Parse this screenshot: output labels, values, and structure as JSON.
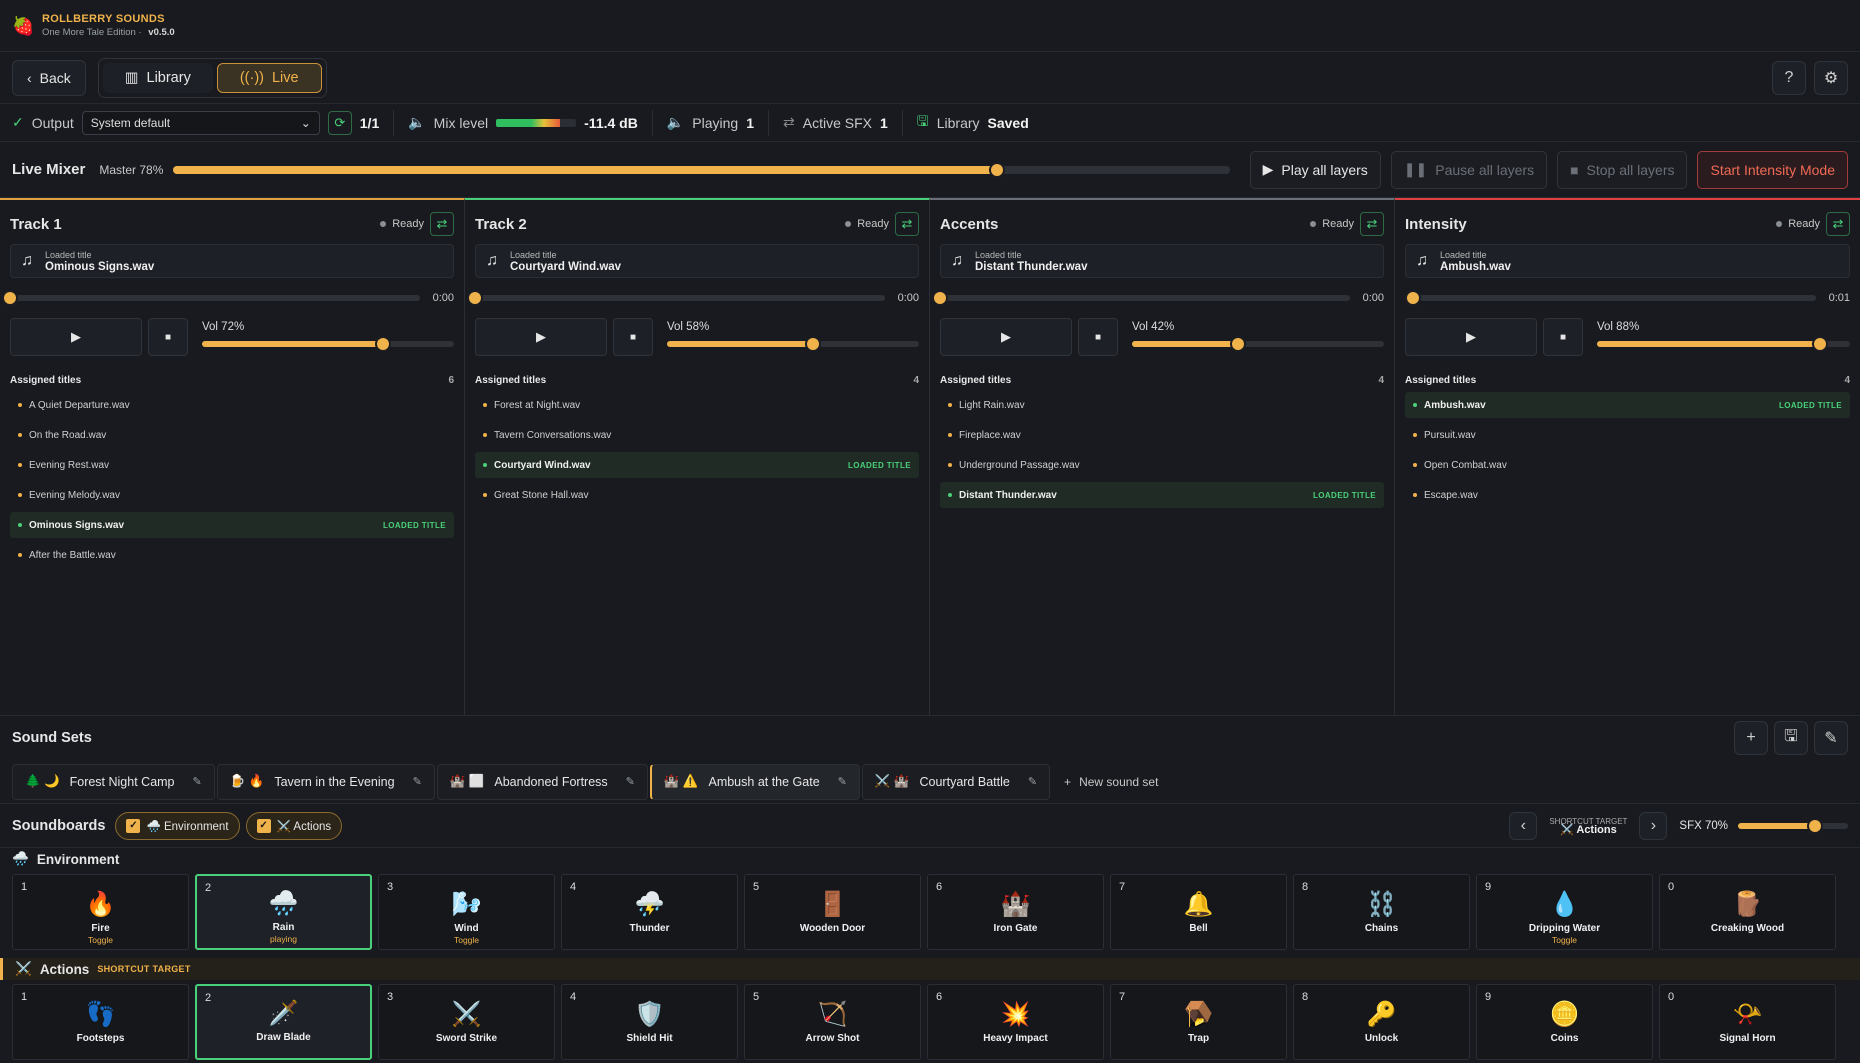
{
  "brand": {
    "name": "ROLLBERRY SOUNDS",
    "edition": "One More Tale Edition",
    "version": "v0.5.0",
    "sep": "·"
  },
  "nav": {
    "back": "Back",
    "library": "Library",
    "live": "Live"
  },
  "status": {
    "output_label": "Output",
    "output_value": "System default",
    "count": "1/1",
    "mix_label": "Mix level",
    "mix_db": "-11.4 dB",
    "mix_level": 0.8,
    "playing_label": "Playing",
    "playing_value": "1",
    "sfx_label": "Active SFX",
    "sfx_value": "1",
    "lib_label": "Library",
    "lib_value": "Saved"
  },
  "mixer": {
    "title": "Live Mixer",
    "master": "Master 78%",
    "master_value": 0.78,
    "play_all": "Play all layers",
    "pause_all": "Pause all layers",
    "stop_all": "Stop all layers",
    "intensity": "Start Intensity Mode"
  },
  "tracks": [
    {
      "name": "Track 1",
      "state": "Ready",
      "accent": "#e0a040",
      "loaded_label": "Loaded title",
      "loaded": "Ominous Signs.wav",
      "time": "0:00",
      "pos": 0.0,
      "vol_label": "Vol 72%",
      "vol": 0.72,
      "assigned_label": "Assigned titles",
      "count": "6",
      "items": [
        "A Quiet Departure.wav",
        "On the Road.wav",
        "Evening Rest.wav",
        "Evening Melody.wav",
        "Ominous Signs.wav",
        "After the Battle.wav"
      ],
      "active": 4
    },
    {
      "name": "Track 2",
      "state": "Ready",
      "accent": "#4ad07a",
      "loaded_label": "Loaded title",
      "loaded": "Courtyard Wind.wav",
      "time": "0:00",
      "pos": 0.0,
      "vol_label": "Vol 58%",
      "vol": 0.58,
      "assigned_label": "Assigned titles",
      "count": "4",
      "items": [
        "Forest at Night.wav",
        "Tavern Conversations.wav",
        "Courtyard Wind.wav",
        "Great Stone Hall.wav"
      ],
      "active": 2
    },
    {
      "name": "Accents",
      "state": "Ready",
      "accent": "#6a6e76",
      "loaded_label": "Loaded title",
      "loaded": "Distant Thunder.wav",
      "time": "0:00",
      "pos": 0.0,
      "vol_label": "Vol 42%",
      "vol": 0.42,
      "assigned_label": "Assigned titles",
      "count": "4",
      "items": [
        "Light Rain.wav",
        "Fireplace.wav",
        "Underground Passage.wav",
        "Distant Thunder.wav"
      ],
      "active": 3
    },
    {
      "name": "Intensity",
      "state": "Ready",
      "accent": "#e04040",
      "loaded_label": "Loaded title",
      "loaded": "Ambush.wav",
      "time": "0:01",
      "pos": 0.02,
      "vol_label": "Vol 88%",
      "vol": 0.88,
      "assigned_label": "Assigned titles",
      "count": "4",
      "items": [
        "Ambush.wav",
        "Pursuit.wav",
        "Open Combat.wav",
        "Escape.wav"
      ],
      "active": 0
    }
  ],
  "loaded_tag": "LOADED TITLE",
  "soundsets": {
    "title": "Sound Sets",
    "new": "New sound set",
    "items": [
      {
        "icons": "🌲 🌙",
        "name": "Forest Night Camp"
      },
      {
        "icons": "🍺 🔥",
        "name": "Tavern in the Evening"
      },
      {
        "icons": "🏰 ⬜",
        "name": "Abandoned Fortress"
      },
      {
        "icons": "🏰 ⚠️",
        "name": "Ambush at the Gate"
      },
      {
        "icons": "⚔️ 🏰",
        "name": "Courtyard Battle"
      }
    ],
    "active": 3
  },
  "soundboards": {
    "title": "Soundboards",
    "chip_env": "🌧️ Environment",
    "chip_act": "⚔️ Actions",
    "target_label": "SHORTCUT TARGET",
    "target_value": "⚔️ Actions",
    "sfx": "SFX 70%",
    "sfx_value": 0.7
  },
  "environment": {
    "title": "Environment",
    "icon": "🌧️",
    "pads": [
      {
        "key": "1",
        "icon": "🔥",
        "name": "Fire",
        "sub": "Toggle"
      },
      {
        "key": "2",
        "icon": "🌧️",
        "name": "Rain",
        "sub": "playing"
      },
      {
        "key": "3",
        "icon": "🌬️",
        "name": "Wind",
        "sub": "Toggle"
      },
      {
        "key": "4",
        "icon": "⛈️",
        "name": "Thunder",
        "sub": ""
      },
      {
        "key": "5",
        "icon": "🚪",
        "name": "Wooden Door",
        "sub": ""
      },
      {
        "key": "6",
        "icon": "🏰",
        "name": "Iron Gate",
        "sub": ""
      },
      {
        "key": "7",
        "icon": "🔔",
        "name": "Bell",
        "sub": ""
      },
      {
        "key": "8",
        "icon": "⛓️",
        "name": "Chains",
        "sub": ""
      },
      {
        "key": "9",
        "icon": "💧",
        "name": "Dripping Water",
        "sub": "Toggle"
      },
      {
        "key": "0",
        "icon": "🪵",
        "name": "Creaking Wood",
        "sub": ""
      }
    ],
    "active": 1
  },
  "actions": {
    "title": "Actions",
    "icon": "⚔️",
    "tag": "SHORTCUT TARGET",
    "pads": [
      {
        "key": "1",
        "icon": "👣",
        "name": "Footsteps",
        "sub": ""
      },
      {
        "key": "2",
        "icon": "🗡️",
        "name": "Draw Blade",
        "sub": ""
      },
      {
        "key": "3",
        "icon": "⚔️",
        "name": "Sword Strike",
        "sub": ""
      },
      {
        "key": "4",
        "icon": "🛡️",
        "name": "Shield Hit",
        "sub": ""
      },
      {
        "key": "5",
        "icon": "🏹",
        "name": "Arrow Shot",
        "sub": ""
      },
      {
        "key": "6",
        "icon": "💥",
        "name": "Heavy Impact",
        "sub": ""
      },
      {
        "key": "7",
        "icon": "🪤",
        "name": "Trap",
        "sub": ""
      },
      {
        "key": "8",
        "icon": "🔑",
        "name": "Unlock",
        "sub": ""
      },
      {
        "key": "9",
        "icon": "🪙",
        "name": "Coins",
        "sub": ""
      },
      {
        "key": "0",
        "icon": "📯",
        "name": "Signal Horn",
        "sub": ""
      }
    ],
    "active": 1
  }
}
